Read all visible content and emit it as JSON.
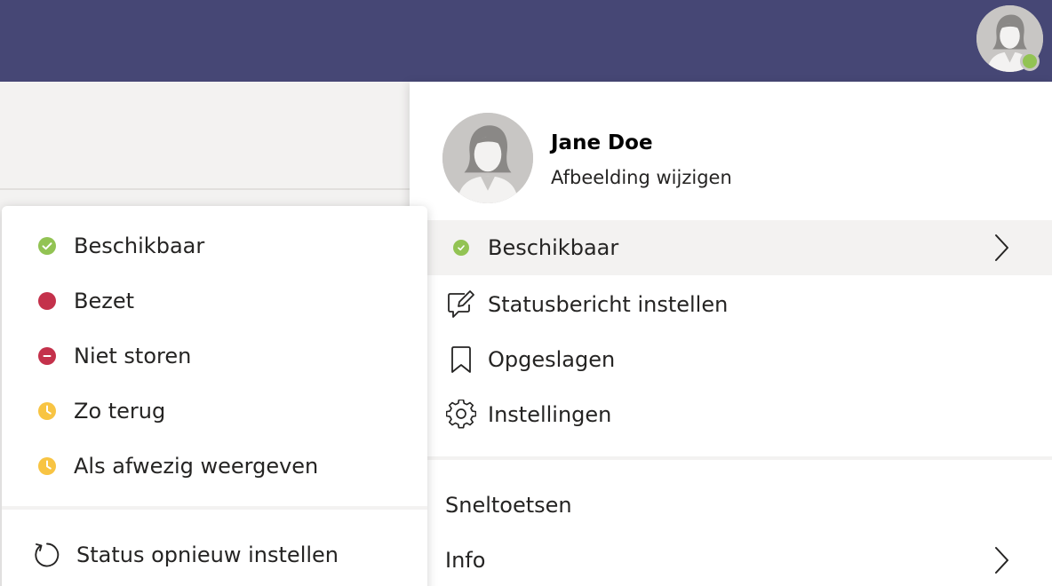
{
  "header": {
    "avatar_icon": "person-avatar-icon",
    "presence_color": "#92c353"
  },
  "profile": {
    "name": "Jane Doe",
    "change_picture": "Afbeelding wijzigen",
    "menu": [
      {
        "label": "Beschikbaar",
        "icon": "available-status-icon",
        "submenu": true
      },
      {
        "label": "Statusbericht instellen",
        "icon": "edit-message-icon"
      },
      {
        "label": "Opgeslagen",
        "icon": "bookmark-icon"
      },
      {
        "label": "Instellingen",
        "icon": "gear-icon"
      }
    ],
    "secondary_menu": [
      {
        "label": "Sneltoetsen"
      },
      {
        "label": "Info",
        "submenu": true
      }
    ]
  },
  "status_menu": {
    "items": [
      {
        "label": "Beschikbaar",
        "icon": "available-icon",
        "color": "#92c353"
      },
      {
        "label": "Bezet",
        "icon": "busy-icon",
        "color": "#c4314b"
      },
      {
        "label": "Niet storen",
        "icon": "do-not-disturb-icon",
        "color": "#c4314b"
      },
      {
        "label": "Zo terug",
        "icon": "be-right-back-icon",
        "color": "#f8c443"
      },
      {
        "label": "Als afwezig weergeven",
        "icon": "away-icon",
        "color": "#f8c443"
      }
    ],
    "reset_label": "Status opnieuw instellen"
  }
}
